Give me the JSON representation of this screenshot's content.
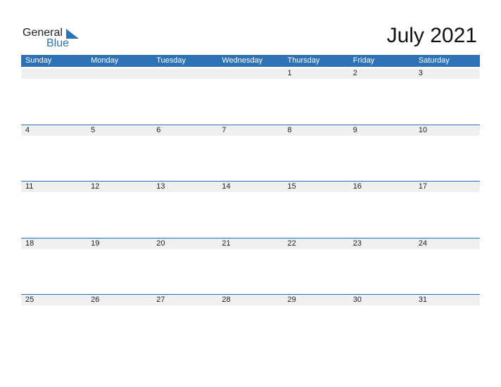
{
  "logo": {
    "line1": "General",
    "line2": "Blue"
  },
  "title": "July 2021",
  "colors": {
    "accent": "#2e72b6",
    "daybar": "#f0f0f0"
  },
  "weekdays": [
    "Sunday",
    "Monday",
    "Tuesday",
    "Wednesday",
    "Thursday",
    "Friday",
    "Saturday"
  ],
  "weeks": [
    [
      "",
      "",
      "",
      "",
      "1",
      "2",
      "3"
    ],
    [
      "4",
      "5",
      "6",
      "7",
      "8",
      "9",
      "10"
    ],
    [
      "11",
      "12",
      "13",
      "14",
      "15",
      "16",
      "17"
    ],
    [
      "18",
      "19",
      "20",
      "21",
      "22",
      "23",
      "24"
    ],
    [
      "25",
      "26",
      "27",
      "28",
      "29",
      "30",
      "31"
    ]
  ]
}
